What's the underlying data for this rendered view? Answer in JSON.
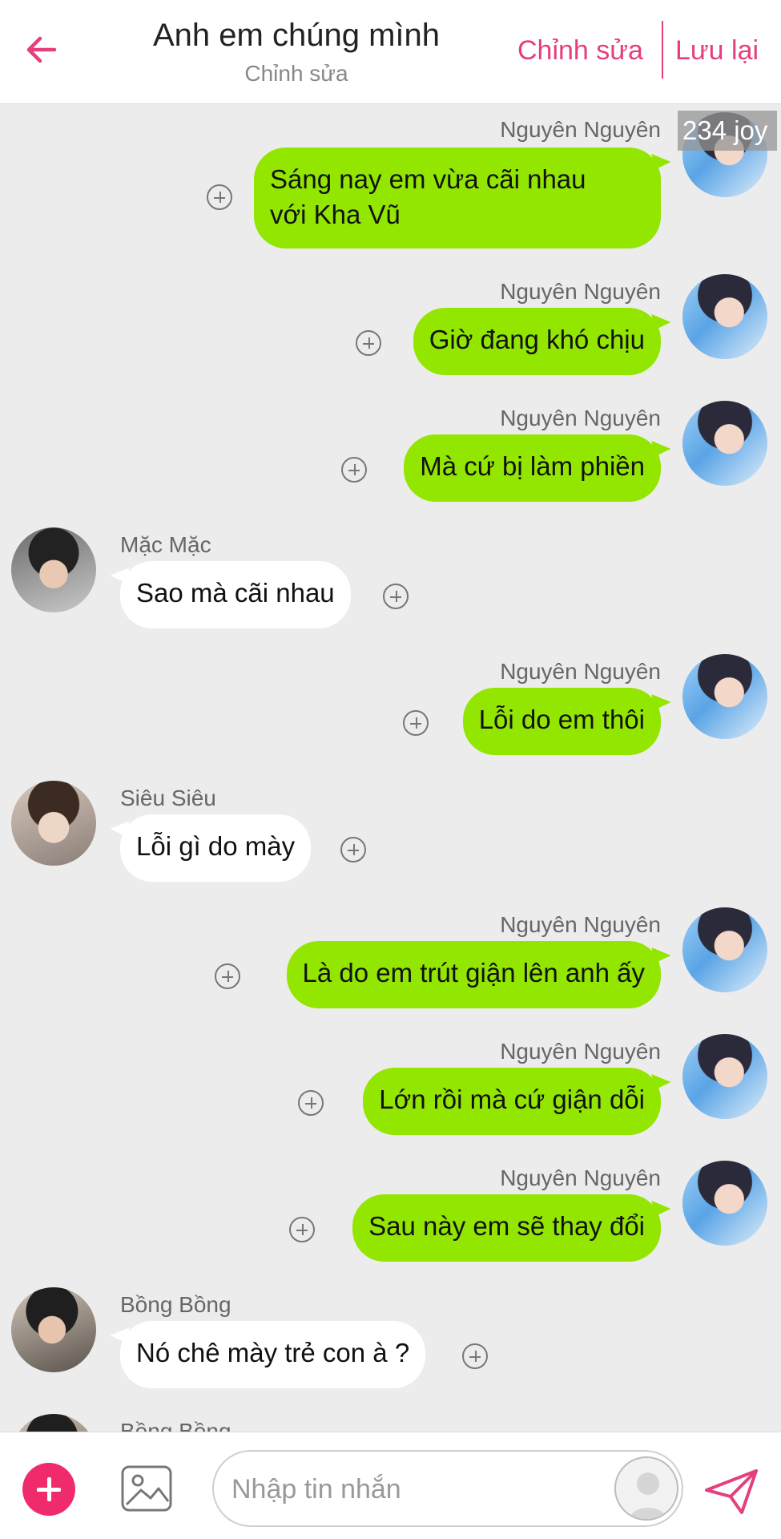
{
  "header": {
    "title": "Anh em chúng mình",
    "subtitle": "Chỉnh sửa",
    "edit_label": "Chỉnh sửa",
    "save_label": "Lưu lại"
  },
  "badge": "234 joy",
  "messages": [
    {
      "sender": "Nguyên Nguyên",
      "line1": "Sáng nay em vừa cãi nhau",
      "line2": "với Kha Vũ"
    },
    {
      "sender": "Nguyên Nguyên",
      "text": "Giờ đang khó chịu"
    },
    {
      "sender": "Nguyên Nguyên",
      "text": "Mà cứ bị làm phiền"
    },
    {
      "sender": "Mặc Mặc",
      "text": "Sao mà cãi nhau"
    },
    {
      "sender": "Nguyên Nguyên",
      "text": "Lỗi do em thôi"
    },
    {
      "sender": "Siêu Siêu",
      "text": "Lỗi gì do mày"
    },
    {
      "sender": "Nguyên Nguyên",
      "text": "Là do em trút giận lên anh ấy"
    },
    {
      "sender": "Nguyên Nguyên",
      "text": "Lớn rồi mà cứ giận dỗi"
    },
    {
      "sender": "Nguyên Nguyên",
      "text": "Sau này em sẽ thay đổi"
    },
    {
      "sender": "Bồng Bồng",
      "text": "Nó chê mày trẻ con à ?"
    },
    {
      "sender": "Bồng Bồng"
    }
  ],
  "composer": {
    "placeholder": "Nhập tin nhắn"
  },
  "colors": {
    "accent": "#e43f7f",
    "bubble_out": "#92e600",
    "bubble_in": "#ffffff",
    "background": "#ececec"
  }
}
